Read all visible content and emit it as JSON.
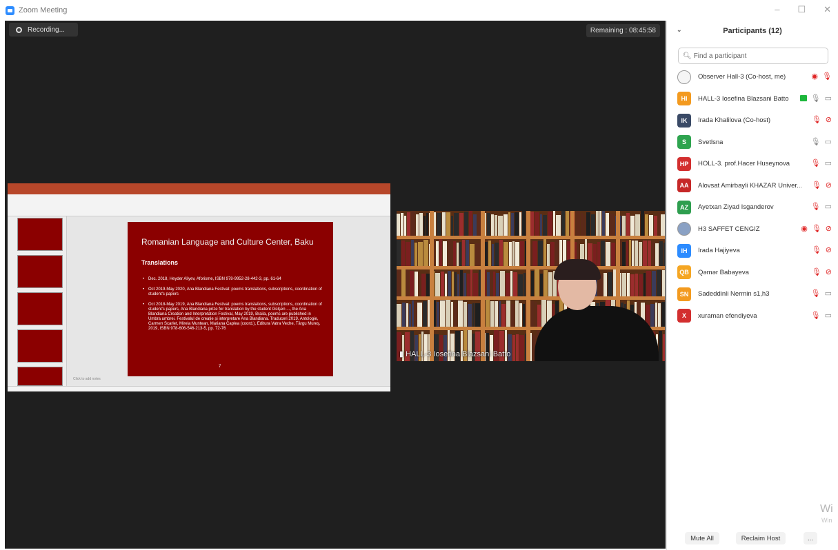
{
  "window": {
    "title": "Zoom Meeting"
  },
  "meeting": {
    "recording_label": "Recording...",
    "remaining_label": "Remaining : 08:45:58"
  },
  "share": {
    "slide_header": "Romanian Language and Culture Center, Baku",
    "slide_title": "Translations",
    "bullets": [
      "Dec. 2018, Heyder Aliyev, Aforisme, ISBN 978-9952-28-442-3, pp. 61-64",
      "Oct 2019-May 2020, Ana Blandiana Festival: poems translations, subscriptions, coordination of student's papers",
      "Oct 2018-May 2019, Ana Blandiana Festival: poems translations, subscriptions, coordination of student's papers, Ana Blandiana prize for translation by the student Gülşen ..., the Ana Blandiana Creation and Interpretation Festival, May 2019, Braila, poems are published in Umbra umbrei. Festivalul de creație și interpretare Ana Blandiana. Traduceri 2019. Antologie, Carmen Scarlet, Mirela Muntean, Mariana Caplea (coord.), Editura Vatra Veche, Târgu Mureș, 2019, ISBN 978-606-546-213-5, pp. 72-76"
    ],
    "page_number": "7",
    "notes_placeholder": "Click to add notes"
  },
  "video": {
    "participant_name": "HALL-3 Iosefina Blazsani Batto"
  },
  "panel": {
    "title": "Participants (12)",
    "search_placeholder": "Find a participant",
    "participants": [
      {
        "initials": "",
        "name": "Observer Hall-3 (Co-host, me)",
        "avatar_color": "#f5f5f5",
        "icons": [
          "record-icon",
          "mic-muted-icon"
        ]
      },
      {
        "initials": "HI",
        "name": "HALL-3 Iosefina Blazsani Batto",
        "avatar_color": "#f39a1f",
        "icons": [
          "screen-share-icon",
          "mic-icon",
          "video-icon"
        ]
      },
      {
        "initials": "IK",
        "name": "Irada Khalilova (Co-host)",
        "avatar_color": "#3a4a66",
        "icons": [
          "mic-muted-icon",
          "video-off-icon"
        ]
      },
      {
        "initials": "S",
        "name": "Svetlsna",
        "avatar_color": "#2ea44f",
        "icons": [
          "mic-icon",
          "video-icon"
        ]
      },
      {
        "initials": "HP",
        "name": "HOLL-3. prof.Hacer Huseynova",
        "avatar_color": "#d32f2f",
        "icons": [
          "mic-muted-icon",
          "video-icon"
        ]
      },
      {
        "initials": "AA",
        "name": "Alovsat Amirbayli KHAZAR Univer...",
        "avatar_color": "#c62828",
        "icons": [
          "mic-muted-icon",
          "video-off-icon"
        ]
      },
      {
        "initials": "AZ",
        "name": "Ayetxan Ziyad Isganderov",
        "avatar_color": "#2e9e4f",
        "icons": [
          "mic-muted-icon",
          "video-icon"
        ]
      },
      {
        "initials": "",
        "name": "H3 SAFFET CENGIZ",
        "avatar_color": "#8aa1c4",
        "icons": [
          "record-icon",
          "mic-muted-icon",
          "video-off-icon"
        ]
      },
      {
        "initials": "IH",
        "name": "Irada Hajiyeva",
        "avatar_color": "#2d8cff",
        "icons": [
          "mic-muted-icon",
          "video-off-icon"
        ]
      },
      {
        "initials": "QB",
        "name": "Qəmər Babayeva",
        "avatar_color": "#f5a623",
        "icons": [
          "mic-muted-icon",
          "video-off-icon"
        ]
      },
      {
        "initials": "SN",
        "name": "Sadeddinli Nermin s1,h3",
        "avatar_color": "#f39a1f",
        "icons": [
          "mic-muted-icon",
          "video-icon"
        ]
      },
      {
        "initials": "X",
        "name": "xuraman efendiyeva",
        "avatar_color": "#d32f2f",
        "icons": [
          "mic-muted-icon",
          "video-icon"
        ]
      }
    ],
    "footer": {
      "mute_all": "Mute All",
      "reclaim_host": "Reclaim Host",
      "more": "..."
    },
    "watermark": "Wi",
    "watermark_sub": "Win"
  }
}
